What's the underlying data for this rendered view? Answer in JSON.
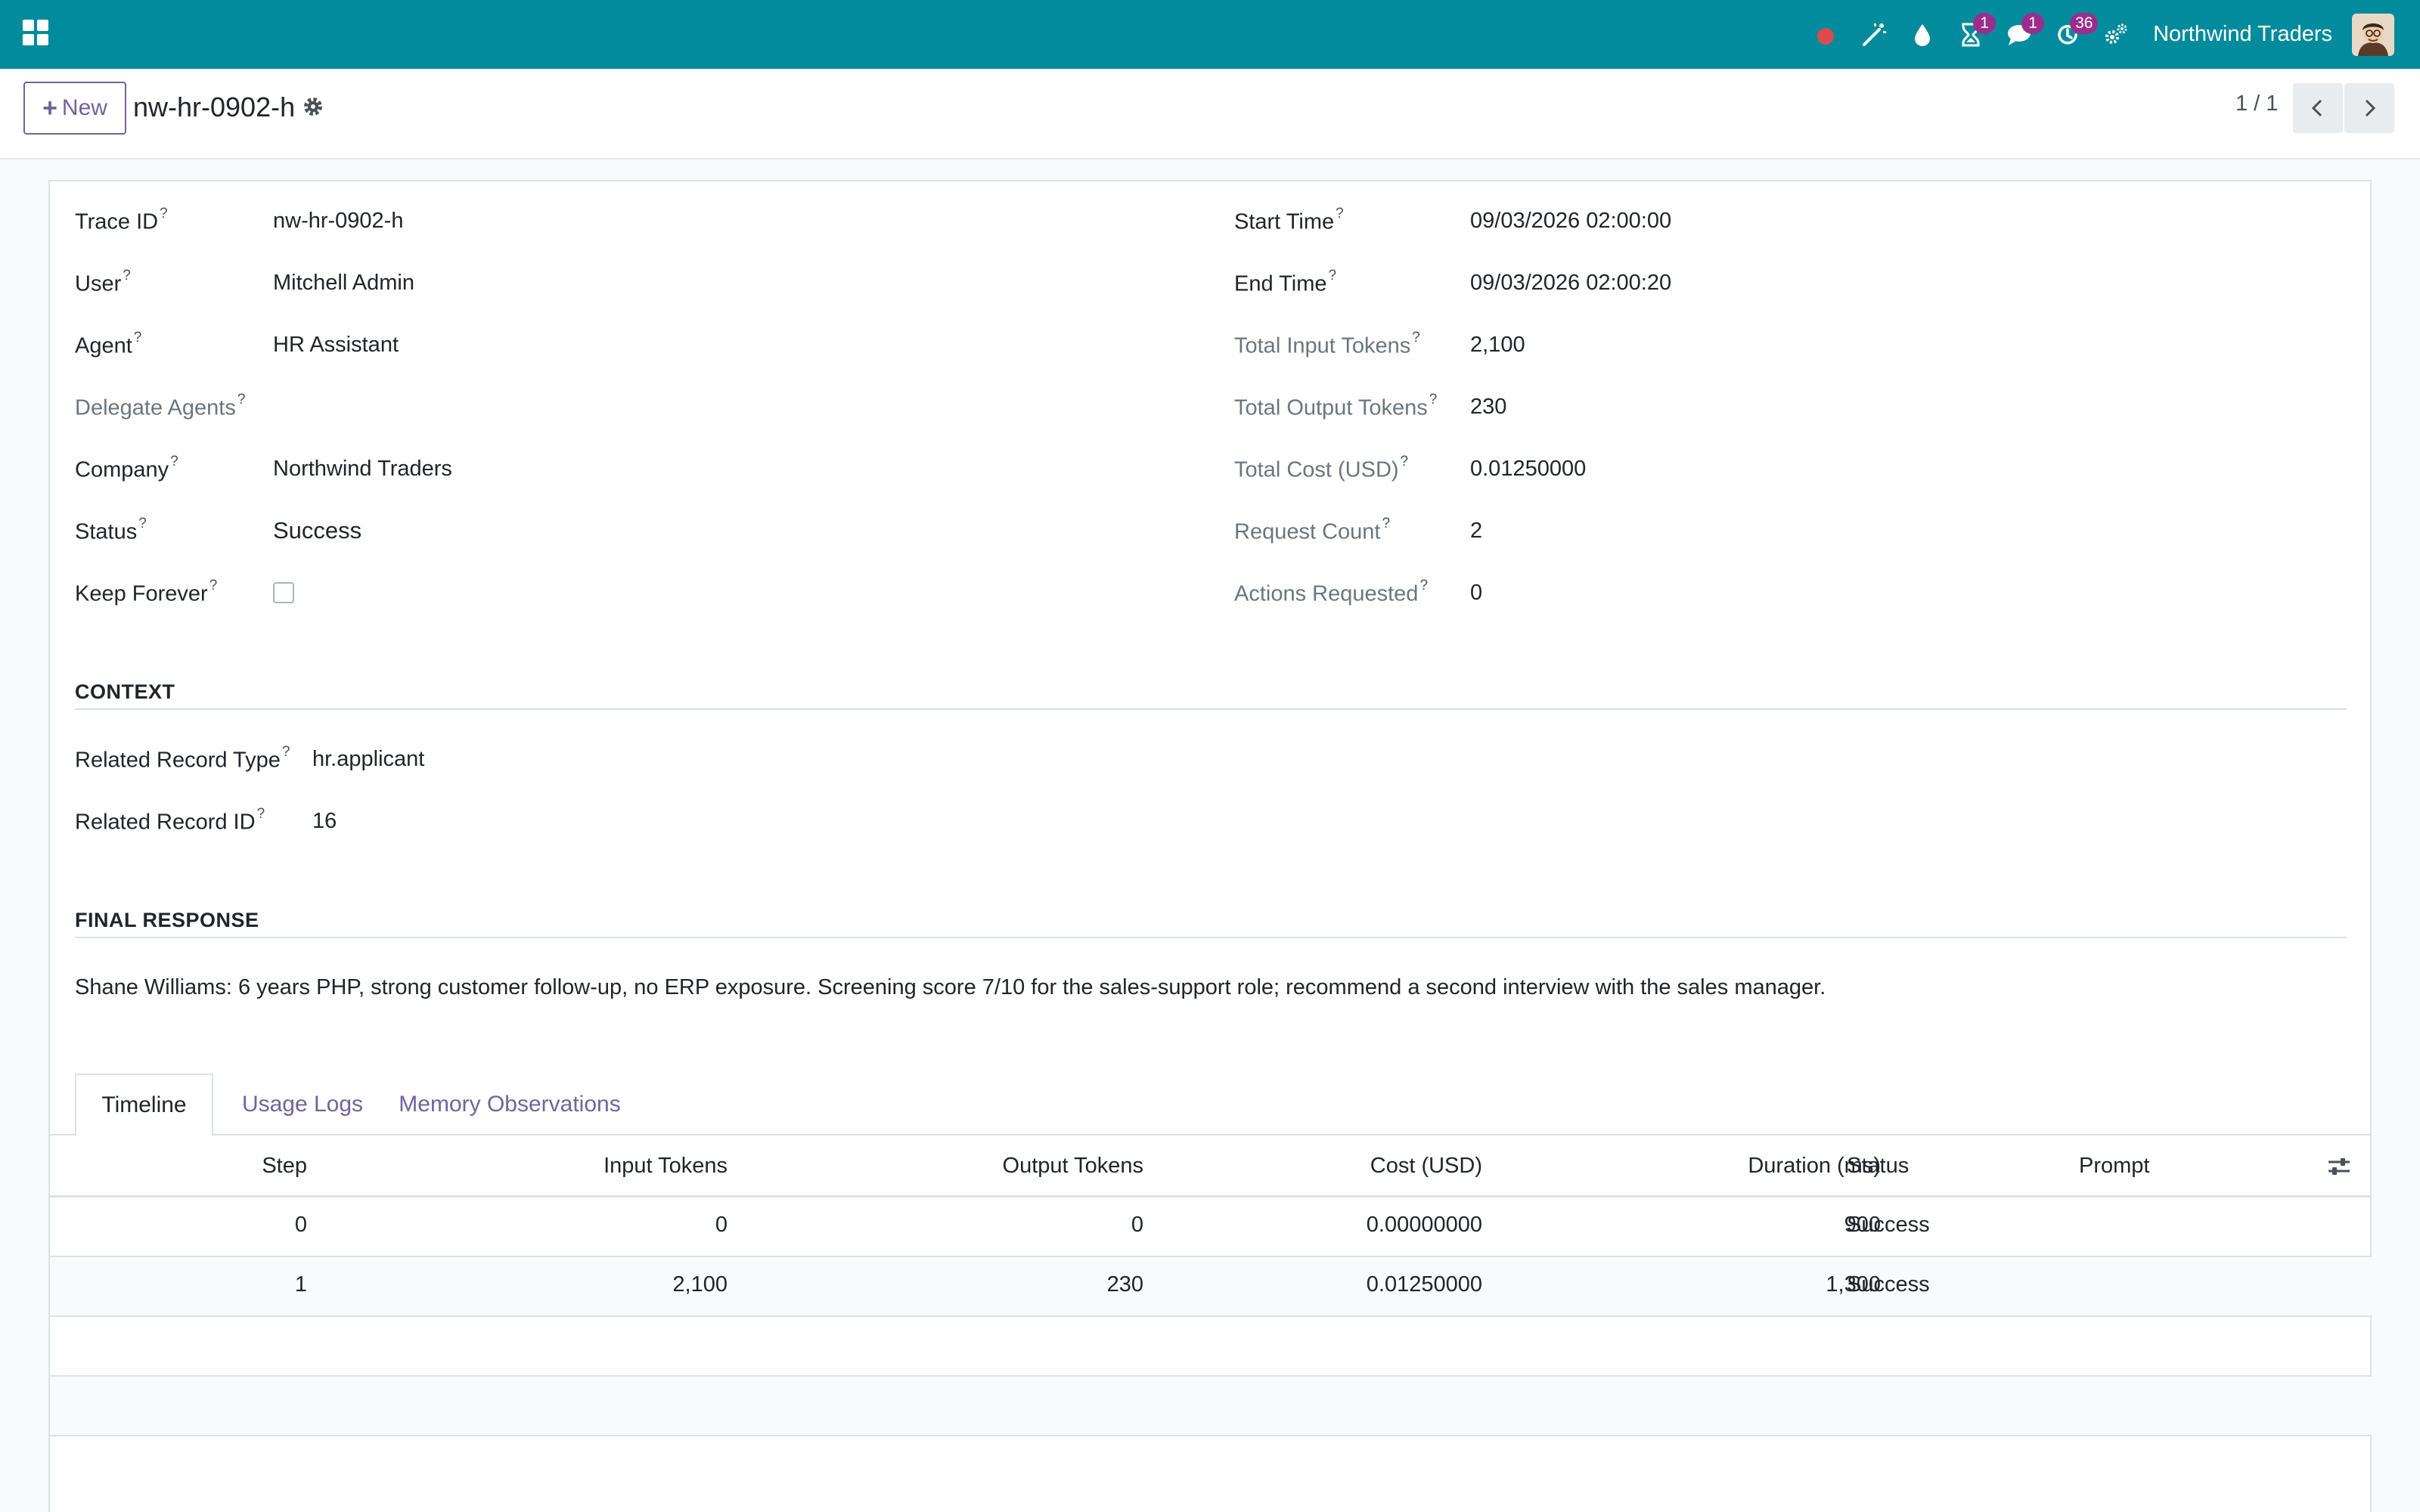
{
  "navbar": {
    "badges": {
      "activity": "1",
      "messages": "1",
      "updates": "36"
    },
    "company": "Northwind Traders",
    "accent": "#018b9c"
  },
  "control": {
    "new_label": "New",
    "record_name": "nw-hr-0902-h",
    "pager": "1 / 1"
  },
  "fields_left": [
    {
      "label": "Trace ID",
      "value": "nw-hr-0902-h"
    },
    {
      "label": "User",
      "value": "Mitchell Admin"
    },
    {
      "label": "Agent",
      "value": "HR Assistant"
    },
    {
      "label": "Delegate Agents",
      "value": ""
    },
    {
      "label": "Company",
      "value": "Northwind Traders"
    },
    {
      "label": "Status",
      "value": "Success"
    },
    {
      "label": "Keep Forever",
      "value": ""
    }
  ],
  "fields_right": [
    {
      "label": "Start Time",
      "value": "09/03/2026 02:00:00"
    },
    {
      "label": "End Time",
      "value": "09/03/2026 02:00:20"
    },
    {
      "label": "Total Input Tokens",
      "value": "2,100"
    },
    {
      "label": "Total Output Tokens",
      "value": "230"
    },
    {
      "label": "Total Cost (USD)",
      "value": "0.01250000"
    },
    {
      "label": "Request Count",
      "value": "2"
    },
    {
      "label": "Actions Requested",
      "value": "0"
    }
  ],
  "context": {
    "title": "CONTEXT",
    "fields": [
      {
        "label": "Related Record Type",
        "value": "hr.applicant"
      },
      {
        "label": "Related Record ID",
        "value": "16"
      }
    ]
  },
  "final_response": {
    "title": "FINAL RESPONSE",
    "text": "Shane Williams: 6 years PHP, strong customer follow-up, no ERP exposure. Screening score 7/10 for the sales-support role; recommend a second interview with the sales manager."
  },
  "tabs": [
    "Timeline",
    "Usage Logs",
    "Memory Observations"
  ],
  "table": {
    "headers": [
      "Step",
      "Input Tokens",
      "Output Tokens",
      "Cost (USD)",
      "Duration (ms)",
      "Status",
      "Prompt"
    ],
    "rows": [
      [
        "0",
        "0",
        "0",
        "0.00000000",
        "900",
        "Success",
        ""
      ],
      [
        "1",
        "2,100",
        "230",
        "0.01250000",
        "1,300",
        "Success",
        ""
      ]
    ]
  },
  "help_mark": "?"
}
